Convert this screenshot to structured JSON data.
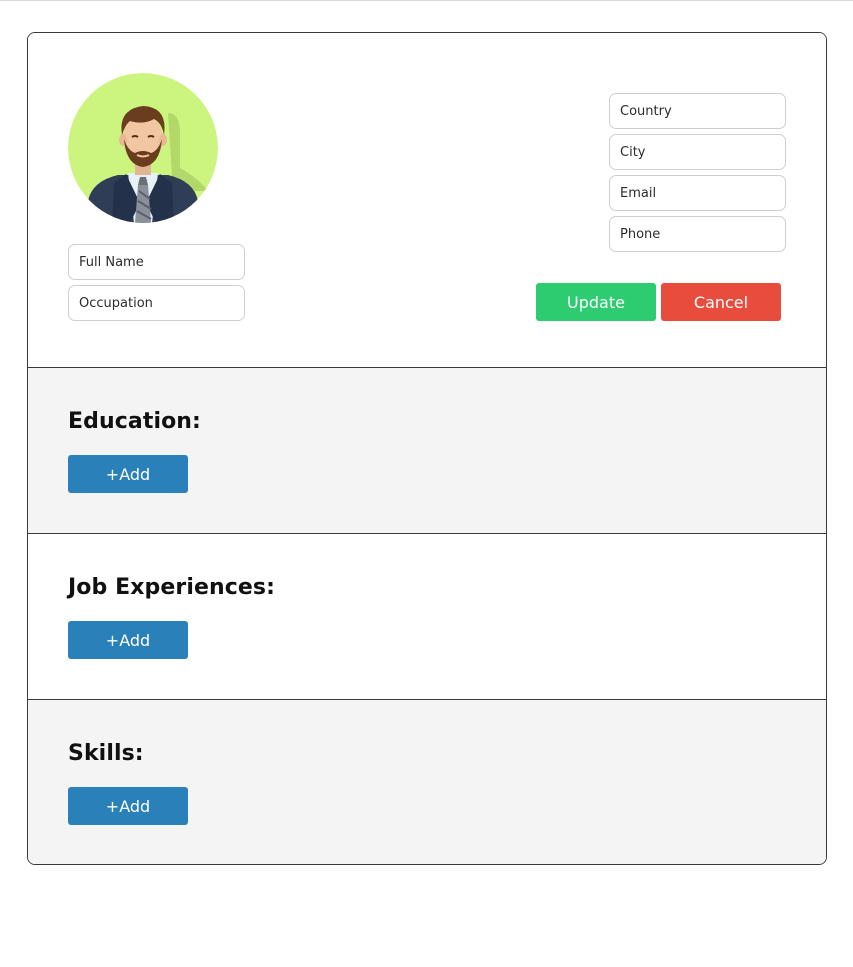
{
  "profile": {
    "full_name_placeholder": "Full Name",
    "occupation_placeholder": "Occupation",
    "country_placeholder": "Country",
    "city_placeholder": "City",
    "email_placeholder": "Email",
    "phone_placeholder": "Phone",
    "update_label": "Update",
    "cancel_label": "Cancel",
    "avatar_icon": "man-avatar-icon"
  },
  "education": {
    "title": "Education:",
    "add_label": "+Add"
  },
  "jobs": {
    "title": "Job Experiences:",
    "add_label": "+Add"
  },
  "skills": {
    "title": "Skills:",
    "add_label": "+Add"
  },
  "colors": {
    "update": "#2ecc71",
    "cancel": "#e74c3c",
    "add": "#2a80b9",
    "avatar_bg": "#ccf57f",
    "section_alt_bg": "#f4f4f4"
  }
}
